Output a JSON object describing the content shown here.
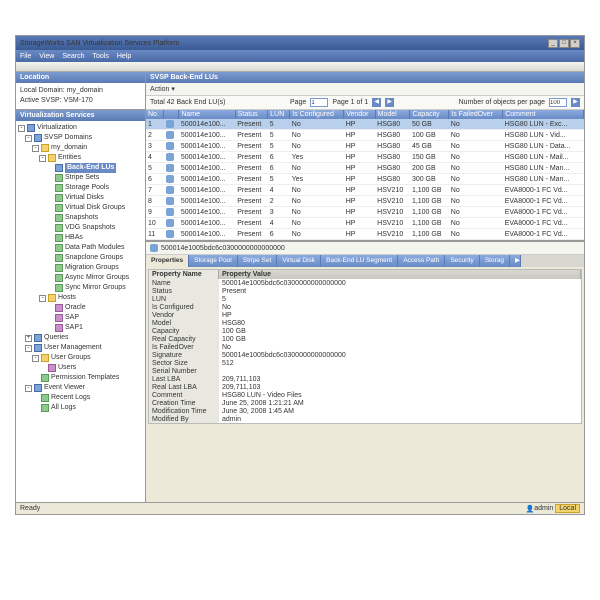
{
  "window": {
    "title": "StorageWorks SAN Virtualization Services Platform"
  },
  "menus": [
    "File",
    "View",
    "Search",
    "Tools",
    "Help"
  ],
  "location": {
    "header": "Location",
    "domain_lbl": "Local Domain:",
    "domain": "my_domain",
    "svsp_lbl": "Active SVSP:",
    "svsp": "VSM-170"
  },
  "tree_header": "Virtualization Services",
  "tree": [
    {
      "d": 0,
      "t": "-",
      "i": "b",
      "l": "Virtualization"
    },
    {
      "d": 1,
      "t": "-",
      "i": "b",
      "l": "SVSP Domains"
    },
    {
      "d": 2,
      "t": "-",
      "i": "f",
      "l": "my_domain"
    },
    {
      "d": 3,
      "t": "-",
      "i": "f",
      "l": "Entities"
    },
    {
      "d": 4,
      "t": "",
      "i": "b",
      "l": "Back-End LUs",
      "sel": true
    },
    {
      "d": 4,
      "t": "",
      "i": "g",
      "l": "Stripe Sets"
    },
    {
      "d": 4,
      "t": "",
      "i": "g",
      "l": "Storage Pools"
    },
    {
      "d": 4,
      "t": "",
      "i": "g",
      "l": "Virtual Disks"
    },
    {
      "d": 4,
      "t": "",
      "i": "g",
      "l": "Virtual Disk Groups"
    },
    {
      "d": 4,
      "t": "",
      "i": "g",
      "l": "Snapshots"
    },
    {
      "d": 4,
      "t": "",
      "i": "g",
      "l": "VDG Snapshots"
    },
    {
      "d": 4,
      "t": "",
      "i": "g",
      "l": "HBAs"
    },
    {
      "d": 4,
      "t": "",
      "i": "g",
      "l": "Data Path Modules"
    },
    {
      "d": 4,
      "t": "",
      "i": "g",
      "l": "Snapclone Groups"
    },
    {
      "d": 4,
      "t": "",
      "i": "g",
      "l": "Migration Groups"
    },
    {
      "d": 4,
      "t": "",
      "i": "g",
      "l": "Async Mirror Groups"
    },
    {
      "d": 4,
      "t": "",
      "i": "g",
      "l": "Sync Mirror Groups"
    },
    {
      "d": 3,
      "t": "-",
      "i": "f",
      "l": "Hosts"
    },
    {
      "d": 4,
      "t": "",
      "i": "p",
      "l": "Oracle"
    },
    {
      "d": 4,
      "t": "",
      "i": "p",
      "l": "SAP"
    },
    {
      "d": 4,
      "t": "",
      "i": "p",
      "l": "SAP1"
    },
    {
      "d": 1,
      "t": "+",
      "i": "b",
      "l": "Queries"
    },
    {
      "d": 1,
      "t": "-",
      "i": "b",
      "l": "User Management"
    },
    {
      "d": 2,
      "t": "-",
      "i": "f",
      "l": "User Groups"
    },
    {
      "d": 3,
      "t": "",
      "i": "p",
      "l": "Users"
    },
    {
      "d": 2,
      "t": "",
      "i": "g",
      "l": "Permission Templates"
    },
    {
      "d": 1,
      "t": "-",
      "i": "b",
      "l": "Event Viewer"
    },
    {
      "d": 2,
      "t": "",
      "i": "g",
      "l": "Recent Logs"
    },
    {
      "d": 2,
      "t": "",
      "i": "g",
      "l": "All Logs"
    }
  ],
  "content_header": "SVSP Back-End LUs",
  "action_label": "Action ▾",
  "pager": {
    "total": "Total 42 Back End LU(s)",
    "page_lbl": "Page",
    "page": "1",
    "of": "Page 1 of 1",
    "objs_lbl": "Number of objects per page",
    "objs": "100"
  },
  "cols": [
    "No.",
    "",
    "Name",
    "Status",
    "LUN",
    "Is Configured",
    "Vendor",
    "Model",
    "Capacity",
    "Is FailedOver",
    "Comment"
  ],
  "rows": [
    {
      "s": 1,
      "c": [
        "1",
        "",
        "500014e100...",
        "Present",
        "5",
        "No",
        "HP",
        "HSG80",
        "50 GB",
        "No",
        "HSG80 LUN - Exc..."
      ]
    },
    {
      "c": [
        "2",
        "",
        "500014e100...",
        "Present",
        "5",
        "No",
        "HP",
        "HSG80",
        "100 GB",
        "No",
        "HSG80 LUN - Vid..."
      ]
    },
    {
      "c": [
        "3",
        "",
        "500014e100...",
        "Present",
        "5",
        "No",
        "HP",
        "HSG80",
        "45 GB",
        "No",
        "HSG80 LUN - Data..."
      ]
    },
    {
      "c": [
        "4",
        "",
        "500014e100...",
        "Present",
        "6",
        "Yes",
        "HP",
        "HSG80",
        "150 GB",
        "No",
        "HSG80 LUN - Mail..."
      ]
    },
    {
      "c": [
        "5",
        "",
        "500014e100...",
        "Present",
        "6",
        "No",
        "HP",
        "HSG80",
        "200 GB",
        "No",
        "HSG80 LUN - Man..."
      ]
    },
    {
      "c": [
        "6",
        "",
        "500014e100...",
        "Present",
        "5",
        "Yes",
        "HP",
        "HSG80",
        "300 GB",
        "No",
        "HSG80 LUN - Man..."
      ]
    },
    {
      "c": [
        "7",
        "",
        "500014e100...",
        "Present",
        "4",
        "No",
        "HP",
        "HSV210",
        "1,100 GB",
        "No",
        "EVA8000-1 FC Vd..."
      ]
    },
    {
      "c": [
        "8",
        "",
        "500014e100...",
        "Present",
        "2",
        "No",
        "HP",
        "HSV210",
        "1,100 GB",
        "No",
        "EVA8000-1 FC Vd..."
      ]
    },
    {
      "c": [
        "9",
        "",
        "500014e100...",
        "Present",
        "3",
        "No",
        "HP",
        "HSV210",
        "1,100 GB",
        "No",
        "EVA8000-1 FC Vd..."
      ]
    },
    {
      "c": [
        "10",
        "",
        "500014e100...",
        "Present",
        "4",
        "No",
        "HP",
        "HSV210",
        "1,100 GB",
        "No",
        "EVA8000-1 FC Vd..."
      ]
    },
    {
      "c": [
        "11",
        "",
        "500014e100...",
        "Present",
        "6",
        "No",
        "HP",
        "HSV210",
        "1,100 GB",
        "No",
        "EVA8000-1 FC Vd..."
      ]
    }
  ],
  "detail_title": "500014e1005bdc6c0300000000000000",
  "dtabs": [
    "Properties",
    "Storage Pool",
    "Stripe Set",
    "Virtual Disk",
    "Back-End LU Segment",
    "Access Path",
    "Security",
    "Storag"
  ],
  "prop_h": {
    "n": "Property Name",
    "v": "Property Value"
  },
  "props": [
    {
      "n": "Name",
      "v": "500014e1005bdc6c0300000000000000"
    },
    {
      "n": "Status",
      "v": "Present"
    },
    {
      "n": "LUN",
      "v": "5"
    },
    {
      "n": "Is Configured",
      "v": "No"
    },
    {
      "n": "Vendor",
      "v": "HP"
    },
    {
      "n": "Model",
      "v": "HSG80"
    },
    {
      "n": "Capacity",
      "v": "100 GB"
    },
    {
      "n": "Real Capacity",
      "v": "100 GB"
    },
    {
      "n": "Is FailedOver",
      "v": "No"
    },
    {
      "n": "Signature",
      "v": "500014e1005bdc6c0300000000000000"
    },
    {
      "n": "Sector Size",
      "v": "512"
    },
    {
      "n": "Serial Number",
      "v": ""
    },
    {
      "n": "Last LBA",
      "v": "209,711,103"
    },
    {
      "n": "Real Last LBA",
      "v": "209,711,103"
    },
    {
      "n": "Comment",
      "v": "HSG80 LUN - Video Files"
    },
    {
      "n": "Creation Time",
      "v": "June 25, 2008 1:21:21 AM"
    },
    {
      "n": "Modification Time",
      "v": "June 30, 2008 1:45 AM"
    },
    {
      "n": "Modified By",
      "v": "admin"
    }
  ],
  "status": {
    "ready": "Ready",
    "user_ic": "👤",
    "user": "admin",
    "local": "Local"
  }
}
